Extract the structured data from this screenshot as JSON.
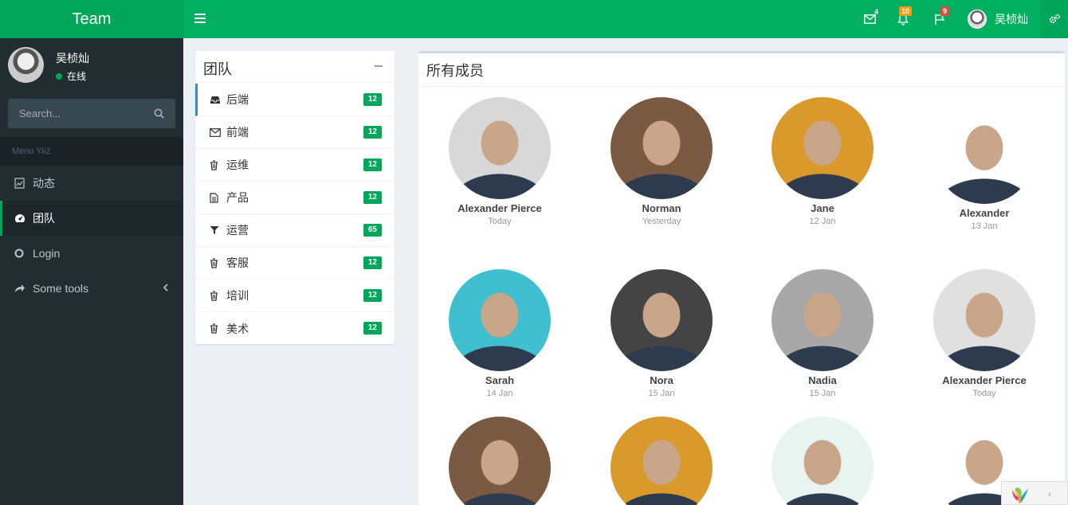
{
  "app": {
    "logo": "Team"
  },
  "topbar": {
    "mail_count": "4",
    "notif_count": "10",
    "task_count": "9",
    "user_name": "吴桢灿",
    "colors": {
      "primary": "#00a65a",
      "mail_badge": "#00a65a",
      "notif_badge": "#f39c12",
      "task_badge": "#dd4b39"
    }
  },
  "sidebar": {
    "user_name": "吴桢灿",
    "user_status": "在线",
    "search_placeholder": "Search...",
    "menu_header": "Menu Yii2",
    "items": [
      {
        "label": "动态",
        "icon": "dashboard-chart-icon"
      },
      {
        "label": "团队",
        "icon": "palette-icon",
        "active": true
      },
      {
        "label": "Login",
        "icon": "circle-icon"
      },
      {
        "label": "Some tools",
        "icon": "share-icon",
        "has_children": true
      }
    ]
  },
  "teams": {
    "title": "团队",
    "items": [
      {
        "label": "后端",
        "count": "12",
        "icon": "inbox-icon"
      },
      {
        "label": "前端",
        "count": "12",
        "icon": "envelope-icon"
      },
      {
        "label": "运维",
        "count": "12",
        "icon": "trash-icon"
      },
      {
        "label": "产品",
        "count": "12",
        "icon": "file-icon"
      },
      {
        "label": "运营",
        "count": "65",
        "icon": "filter-icon"
      },
      {
        "label": "客服",
        "count": "12",
        "icon": "trash-icon"
      },
      {
        "label": "培训",
        "count": "12",
        "icon": "trash-icon"
      },
      {
        "label": "美术",
        "count": "12",
        "icon": "trash-icon"
      }
    ]
  },
  "members": {
    "title": "所有成员",
    "list": [
      {
        "name": "Alexander Pierce",
        "date": "Today",
        "color": "#d8d8d8"
      },
      {
        "name": "Norman",
        "date": "Yesterday",
        "color": "#7a5a42"
      },
      {
        "name": "Jane",
        "date": "12 Jan",
        "color": "#d99a2b"
      },
      {
        "name": "Alexander",
        "date": "13 Jan",
        "color": "#ffffff"
      },
      {
        "name": "Sarah",
        "date": "14 Jan",
        "color": "#3fbfcf"
      },
      {
        "name": "Nora",
        "date": "15 Jan",
        "color": "#444444"
      },
      {
        "name": "Nadia",
        "date": "15 Jan",
        "color": "#a8a8a8"
      },
      {
        "name": "Alexander Pierce",
        "date": "Today",
        "color": "#e0e0e0"
      },
      {
        "name": "",
        "date": "",
        "color": "#7a5a42"
      },
      {
        "name": "",
        "date": "",
        "color": "#d99a2b"
      },
      {
        "name": "",
        "date": "",
        "color": "#e8f4f0"
      },
      {
        "name": "",
        "date": "",
        "color": "#ffffff"
      }
    ]
  }
}
